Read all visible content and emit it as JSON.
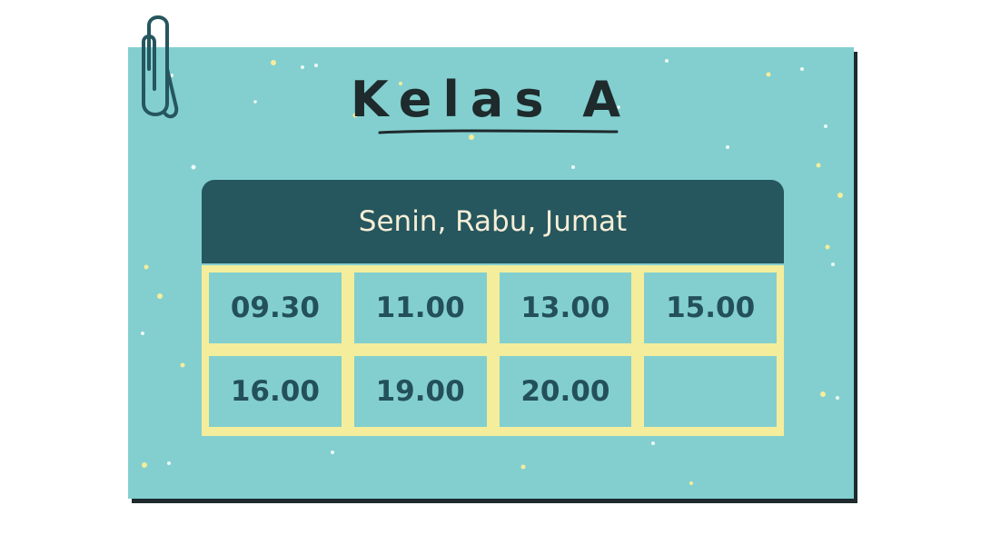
{
  "card": {
    "title": "Kelas A",
    "days": "Senin, Rabu, Jumat",
    "times": [
      "09.30",
      "11.00",
      "13.00",
      "15.00",
      "16.00",
      "19.00",
      "20.00",
      ""
    ]
  },
  "colors": {
    "card_bg": "#83cfcf",
    "header_bg": "#26565e",
    "grid_lines": "#f4ed9b",
    "title_text": "#1e2a2c",
    "time_text": "#23505a",
    "header_text": "#f5eed6"
  },
  "icons": {
    "clip": "paperclip-icon"
  }
}
